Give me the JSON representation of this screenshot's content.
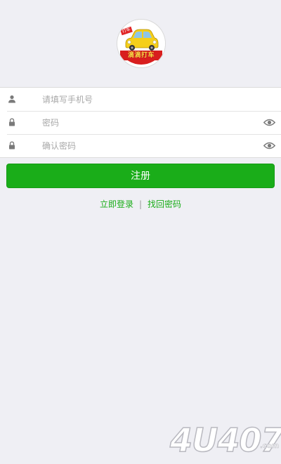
{
  "logo": {
    "icon": "taxi-car-icon",
    "text": "滴滴打车",
    "tag": "打车"
  },
  "form": {
    "phone": {
      "icon": "user-icon",
      "placeholder": "请填写手机号",
      "value": ""
    },
    "password": {
      "icon": "lock-icon",
      "placeholder": "密码",
      "value": "",
      "toggle_icon": "eye-icon"
    },
    "confirm_password": {
      "icon": "lock-icon",
      "placeholder": "确认密码",
      "value": "",
      "toggle_icon": "eye-icon"
    }
  },
  "register_button": {
    "label": "注册"
  },
  "links": {
    "login": "立即登录",
    "separator": "|",
    "recover": "找回密码"
  },
  "watermark": {
    "text": "4U407",
    "domain": ".com"
  },
  "colors": {
    "background": "#efeff4",
    "accent": "#1aad19",
    "placeholder": "#a8a8a8",
    "icon": "#7a7a7a"
  }
}
